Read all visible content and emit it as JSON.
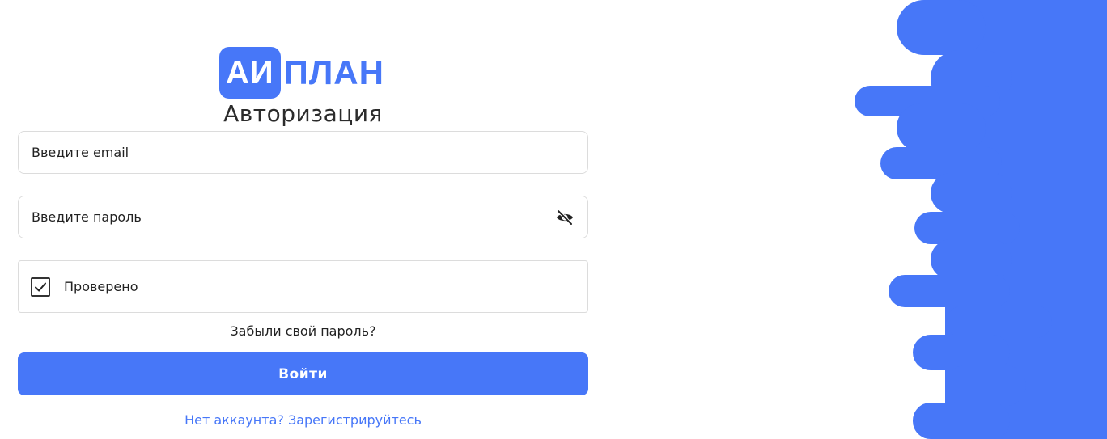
{
  "logo": {
    "badge_text": "АИ",
    "text": "ПЛАН"
  },
  "auth": {
    "title": "Авторизация",
    "email_placeholder": "Введите email",
    "password_placeholder": "Введите пароль",
    "verify_label": "Проверено",
    "verify_checked": true,
    "forgot_link": "Забыли свой пароль?",
    "login_button": "Войти",
    "register_link": "Нет аккаунта? Зарегистрируйтесь"
  },
  "icons": {
    "password_toggle": "eye-off-icon",
    "checkbox": "checkmark-icon"
  },
  "colors": {
    "accent": "#4777f8",
    "text": "#222222",
    "border": "#dcdcdc"
  }
}
